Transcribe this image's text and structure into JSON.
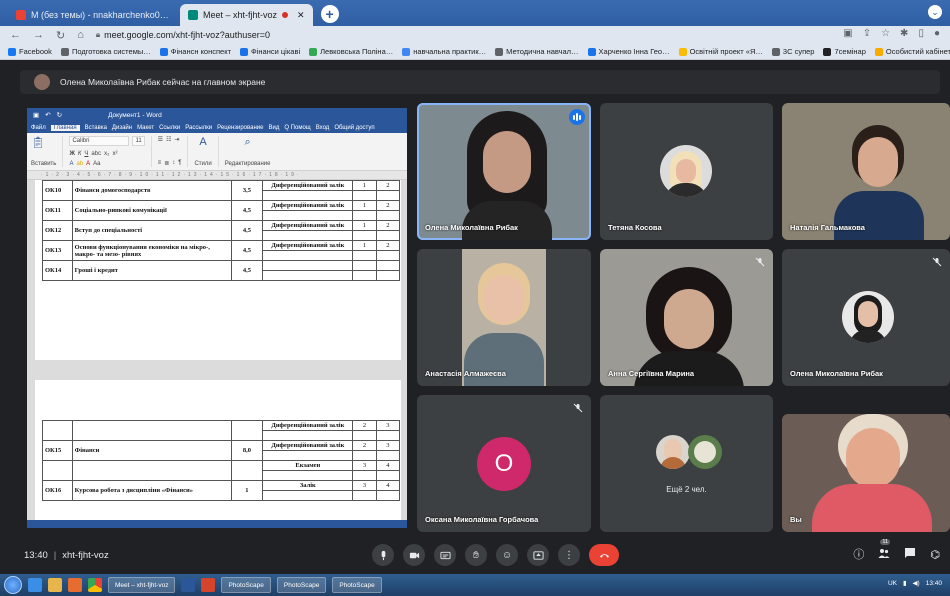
{
  "browser": {
    "tabs": [
      {
        "title": "M  (без темы) - nnakharchenko0…",
        "color": "#ea4335",
        "active": false
      },
      {
        "title": "Meet – xht-fjht-voz",
        "color": "#00897b",
        "active": true
      }
    ],
    "url": "meet.google.com/xht-fjht-voz?authuser=0",
    "bookmarks": [
      {
        "label": "Facebook",
        "color": "#1877f2"
      },
      {
        "label": "Подготовка системы…",
        "color": "#5f6368"
      },
      {
        "label": "Фінансн конспект",
        "color": "#1a73e8"
      },
      {
        "label": "Фінанси цікаві",
        "color": "#1a73e8"
      },
      {
        "label": "Левковська Поліна…",
        "color": "#34a853"
      },
      {
        "label": "навчальна практик…",
        "color": "#4285f4"
      },
      {
        "label": "Методична навчал…",
        "color": "#5f6368"
      },
      {
        "label": "Харченко Інна Гео…",
        "color": "#1a73e8"
      },
      {
        "label": "Освітній проект «Я…",
        "color": "#fbbc04"
      },
      {
        "label": "3С супер",
        "color": "#5f6368"
      },
      {
        "label": "7семінар",
        "color": "#202124"
      },
      {
        "label": "Особистий кабінет…",
        "color": "#f9ab00"
      }
    ]
  },
  "meet": {
    "presenting_text": "Олена Миколаївна Рибак сейчас на главном экране",
    "meeting_time": "13:40",
    "meeting_code": "xht-fjht-voz",
    "more_count_badge": "11",
    "participants": [
      {
        "name": "Олена Миколаївна Рибак",
        "speaking": true
      },
      {
        "name": "Тетяна Косова"
      },
      {
        "name": "Наталія Гальмакова"
      },
      {
        "name": "Анастасія Алмажеєва"
      },
      {
        "name": "Анна Сергіївна Марина"
      },
      {
        "name": "Олена Миколаївна Рибак"
      },
      {
        "name": "Оксана Миколаївна Горбачова",
        "initial": "О"
      },
      {
        "name": "",
        "more_text": "Ещё 2 чел."
      },
      {
        "name": "Вы"
      }
    ]
  },
  "doc": {
    "window_title": "Документ1 - Word",
    "ribbon_tabs": [
      "Файл",
      "Главная",
      "Вставка",
      "Дизайн",
      "Макет",
      "Ссылки",
      "Рассылки",
      "Рецензирование",
      "Вид",
      "Q Помощ",
      "Вход",
      "Общий доступ"
    ],
    "font_name": "Calibri",
    "font_size": "11",
    "paste_label": "Вставить",
    "styles_label": "Стили",
    "edit_label": "Редактирование",
    "rows1": [
      {
        "code": "ОК10",
        "name": "Фінанси домогосподарств",
        "cred": "3,5",
        "ctl": "Диференційований залік",
        "a": "1",
        "b": "2"
      },
      {
        "code": "ОК11",
        "name": "Соціально-ринкові комунікації",
        "cred": "4,5",
        "ctl": "Диференційований залік",
        "a": "1",
        "b": "2"
      },
      {
        "code": "ОК12",
        "name": "Вступ до спеціальності",
        "cred": "4,5",
        "ctl": "Диференційований залік",
        "a": "1",
        "b": "2"
      },
      {
        "code": "ОК13",
        "name": "Основи функціонування економіки на мікро-, макро- та мезо- рівнях",
        "cred": "4,5",
        "ctl": "Диференційований залік",
        "a": "1",
        "b": "2"
      },
      {
        "code": "ОК14",
        "name": "Гроші і кредит",
        "cred": "4,5",
        "ctl": "",
        "a": "",
        "b": ""
      }
    ],
    "rows2": [
      {
        "code": "",
        "name": "",
        "cred": "",
        "ctl": "Диференційований залік",
        "a": "2",
        "b": "3"
      },
      {
        "code": "ОК15",
        "name": "Фінанси",
        "cred": "8,0",
        "ctl": "Диференційований залік",
        "a": "2",
        "b": "3"
      },
      {
        "code": "",
        "name": "",
        "cred": "",
        "ctl": "Екзамен",
        "a": "3",
        "b": "4"
      },
      {
        "code": "ОК16",
        "name": "Курсова робота з дисципліни «Фінанси»",
        "cred": "1",
        "ctl": "Залік",
        "a": "3",
        "b": "4"
      }
    ]
  },
  "taskbar": {
    "tasks": [
      "Meet – xht-fjht-voz",
      "PhotoScape",
      "PhotoScape",
      "PhotoScape"
    ],
    "lang": "UK",
    "clock": "13:40"
  },
  "colors": {
    "accent": "#1a73e8",
    "hangup": "#ea4335",
    "avatar_o": "#d0296b",
    "word_blue": "#2b579a"
  }
}
